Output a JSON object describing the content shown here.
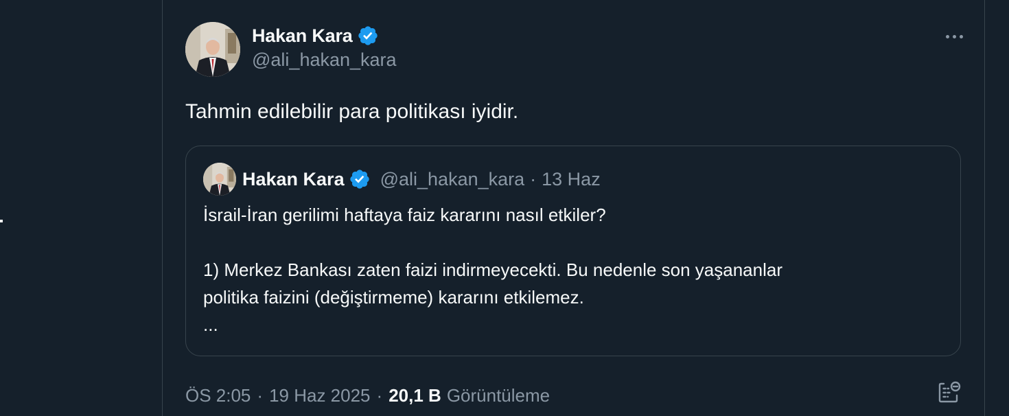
{
  "tweet": {
    "author": {
      "display_name": "Hakan Kara",
      "handle": "@ali_hakan_kara",
      "verified_icon": "verified-badge-icon"
    },
    "more_icon": "more-horizontal-icon",
    "text": "Tahmin edilebilir para politikası iyidir.",
    "quoted": {
      "display_name": "Hakan Kara",
      "handle": "@ali_hakan_kara",
      "separator": "·",
      "date": "13 Haz",
      "lines": [
        "İsrail-İran gerilimi haftaya faiz kararını nasıl etkiler?",
        "1) Merkez Bankası zaten faizi indirmeyecekti. Bu nedenle son yaşananlar",
        "politika faizini (değiştirmeme) kararını etkilemez.",
        "..."
      ]
    },
    "meta": {
      "time": "ÖS 2:05",
      "separator": "·",
      "date": "19 Haz 2025",
      "views_count": "20,1 B",
      "views_label": "Görüntüleme"
    },
    "analytics_icon": "analytics-icon"
  },
  "colors": {
    "background": "#15202b",
    "border": "#38444d",
    "text_primary": "#f7f9f9",
    "text_secondary": "#8b98a5",
    "verified": "#1d9bf0"
  }
}
